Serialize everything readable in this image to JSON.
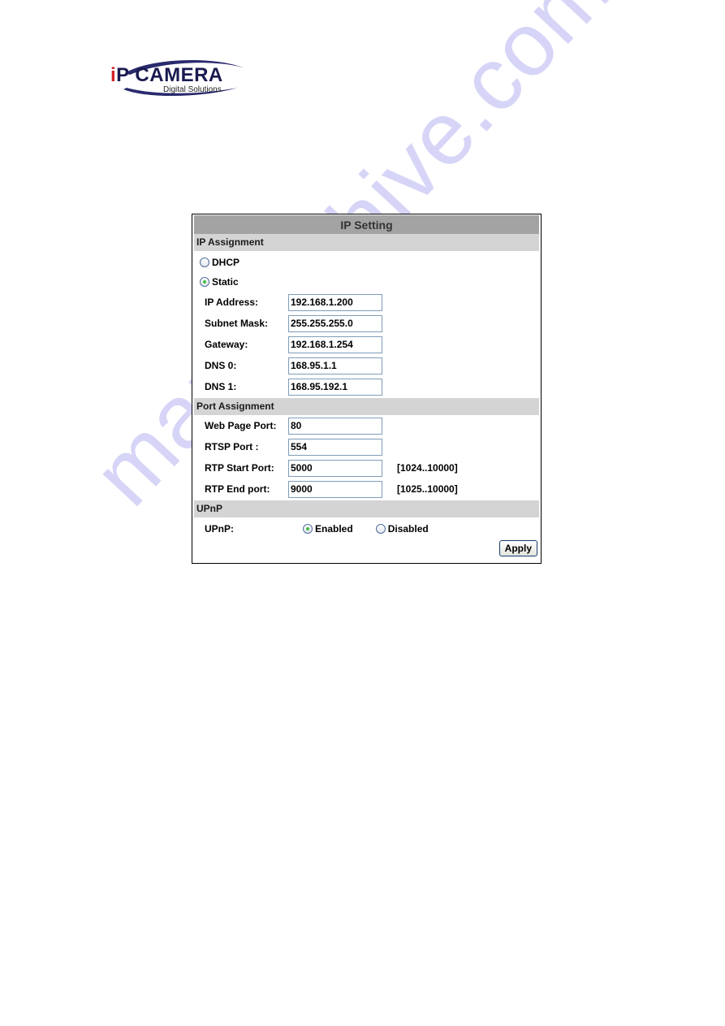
{
  "watermark": "manualshive.com",
  "logo": {
    "brand_i": "i",
    "brand_rest": "P CAMERA",
    "tagline": "Digital Solutions",
    "colors": {
      "red": "#d31f26",
      "navy": "#1a1a50"
    }
  },
  "panel": {
    "title": "IP Setting",
    "sections": {
      "ip_assignment": {
        "header": "IP Assignment",
        "modes": [
          {
            "label": "DHCP",
            "checked": false
          },
          {
            "label": "Static",
            "checked": true
          }
        ],
        "fields": [
          {
            "label": "IP Address:",
            "value": "192.168.1.200"
          },
          {
            "label": "Subnet Mask:",
            "value": "255.255.255.0"
          },
          {
            "label": "Gateway:",
            "value": "192.168.1.254"
          },
          {
            "label": "DNS 0:",
            "value": "168.95.1.1"
          },
          {
            "label": "DNS 1:",
            "value": "168.95.192.1"
          }
        ]
      },
      "port_assignment": {
        "header": "Port Assignment",
        "fields": [
          {
            "label": "Web Page Port:",
            "value": "80",
            "range": ""
          },
          {
            "label": "RTSP Port :",
            "value": "554",
            "range": ""
          },
          {
            "label": "RTP Start Port:",
            "value": "5000",
            "range": "[1024..10000]"
          },
          {
            "label": "RTP End port:",
            "value": "9000",
            "range": "[1025..10000]"
          }
        ]
      },
      "upnp": {
        "header": "UPnP",
        "label": "UPnP:",
        "options": [
          {
            "label": "Enabled",
            "checked": true
          },
          {
            "label": "Disabled",
            "checked": false
          }
        ]
      }
    },
    "apply_label": "Apply",
    "colors": {
      "title_bg": "#a3a3a3",
      "section_bg": "#d4d4d4",
      "radio_dot": "#3fbf3f"
    }
  }
}
